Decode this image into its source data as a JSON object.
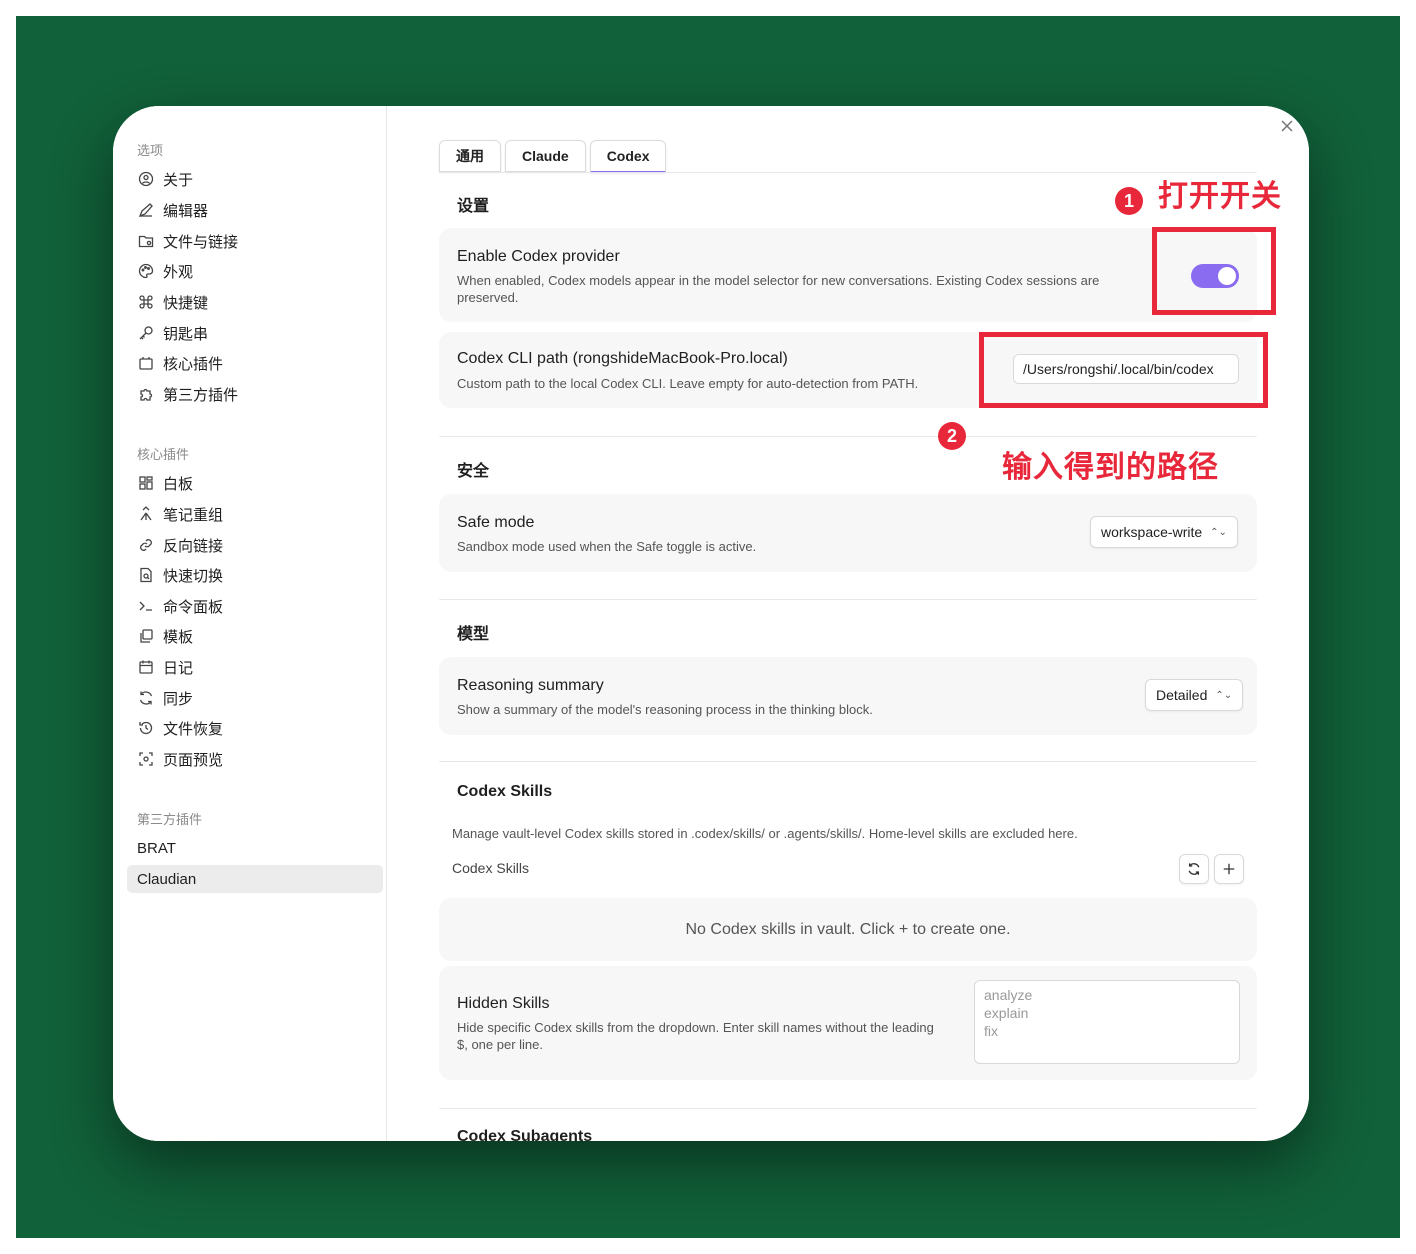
{
  "sidebar": {
    "section_options": "选项",
    "options": [
      {
        "label": "关于"
      },
      {
        "label": "编辑器"
      },
      {
        "label": "文件与链接"
      },
      {
        "label": "外观"
      },
      {
        "label": "快捷键"
      },
      {
        "label": "钥匙串"
      },
      {
        "label": "核心插件"
      },
      {
        "label": "第三方插件"
      }
    ],
    "section_core": "核心插件",
    "core": [
      {
        "label": "白板"
      },
      {
        "label": "笔记重组"
      },
      {
        "label": "反向链接"
      },
      {
        "label": "快速切换"
      },
      {
        "label": "命令面板"
      },
      {
        "label": "模板"
      },
      {
        "label": "日记"
      },
      {
        "label": "同步"
      },
      {
        "label": "文件恢复"
      },
      {
        "label": "页面预览"
      }
    ],
    "section_third": "第三方插件",
    "third": [
      {
        "label": "BRAT"
      },
      {
        "label": "Claudian"
      }
    ]
  },
  "tabs": [
    {
      "label": "通用"
    },
    {
      "label": "Claude"
    },
    {
      "label": "Codex"
    }
  ],
  "groups": {
    "settings_title": "设置",
    "security_title": "安全",
    "model_title": "模型",
    "skills_title": "Codex Skills",
    "subagents_title": "Codex Subagents"
  },
  "enable_provider": {
    "name": "Enable Codex provider",
    "desc": "When enabled, Codex models appear in the model selector for new conversations. Existing Codex sessions are preserved.",
    "enabled": true
  },
  "cli_path": {
    "name": "Codex CLI path (rongshideMacBook-Pro.local)",
    "desc": "Custom path to the local Codex CLI. Leave empty for auto-detection from PATH.",
    "value": "/Users/rongshi/.local/bin/codex"
  },
  "safe_mode": {
    "name": "Safe mode",
    "desc": "Sandbox mode used when the Safe toggle is active.",
    "value": "workspace-write"
  },
  "reasoning": {
    "name": "Reasoning summary",
    "desc": "Show a summary of the model's reasoning process in the thinking block.",
    "value": "Detailed"
  },
  "skills": {
    "desc": "Manage vault-level Codex skills stored in .codex/skills/ or .agents/skills/. Home-level skills are excluded here.",
    "list_label": "Codex Skills",
    "empty_text": "No Codex skills in vault. Click + to create one."
  },
  "hidden_skills": {
    "name": "Hidden Skills",
    "desc": "Hide specific Codex skills from the dropdown. Enter skill names without the leading $, one per line.",
    "placeholder_lines": [
      "analyze",
      "explain",
      "fix"
    ]
  },
  "annotations": {
    "badge1": "1",
    "text1": "打开开关",
    "badge2": "2",
    "text2": "输入得到的路径",
    "color": "#e8283a"
  },
  "colors": {
    "background": "#11613a",
    "accent": "#8a6cf0"
  }
}
